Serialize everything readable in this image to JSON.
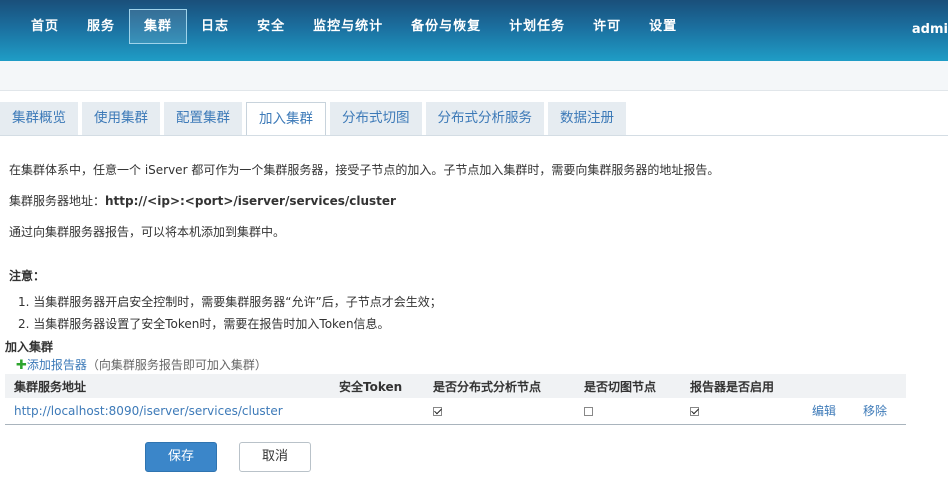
{
  "nav": {
    "items": [
      "首页",
      "服务",
      "集群",
      "日志",
      "安全",
      "监控与统计",
      "备份与恢复",
      "计划任务",
      "许可",
      "设置"
    ],
    "active_index": 2,
    "user": "admi"
  },
  "tabs": {
    "items": [
      "集群概览",
      "使用集群",
      "配置集群",
      "加入集群",
      "分布式切图",
      "分布式分析服务",
      "数据注册"
    ],
    "active_index": 3
  },
  "content": {
    "intro": "在集群体系中，任意一个 iServer 都可作为一个集群服务器，接受子节点的加入。子节点加入集群时，需要向集群服务器的地址报告。",
    "address_label": "集群服务器地址：",
    "address_value": "http://<ip>:<port>/iserver/services/cluster",
    "report_text": "通过向集群服务器报告，可以将本机添加到集群中。",
    "note_title": "注意：",
    "note_1": "1. 当集群服务器开启安全控制时，需要集群服务器“允许”后，子节点才会生效；",
    "note_2": "2. 当集群服务器设置了安全Token时，需要在报告时加入Token信息。"
  },
  "join": {
    "section_title": "加入集群",
    "add_reporter": "添加报告器",
    "add_hint": "（向集群服务报告即可加入集群）",
    "columns": [
      "集群服务地址",
      "安全Token",
      "是否分布式分析节点",
      "是否切图节点",
      "报告器是否启用"
    ],
    "rows": [
      {
        "url": "http://localhost:8090/iserver/services/cluster",
        "token": "",
        "is_analysis_node": true,
        "is_tile_node": false,
        "reporter_enabled": true,
        "edit": "编辑",
        "remove": "移除"
      }
    ]
  },
  "buttons": {
    "save": "保存",
    "cancel": "取消"
  },
  "colors": {
    "header_top": "#1a4f7a",
    "header_bottom": "#1f9dc6",
    "link": "#3d7ab8",
    "primary_button": "#3b86c9"
  }
}
